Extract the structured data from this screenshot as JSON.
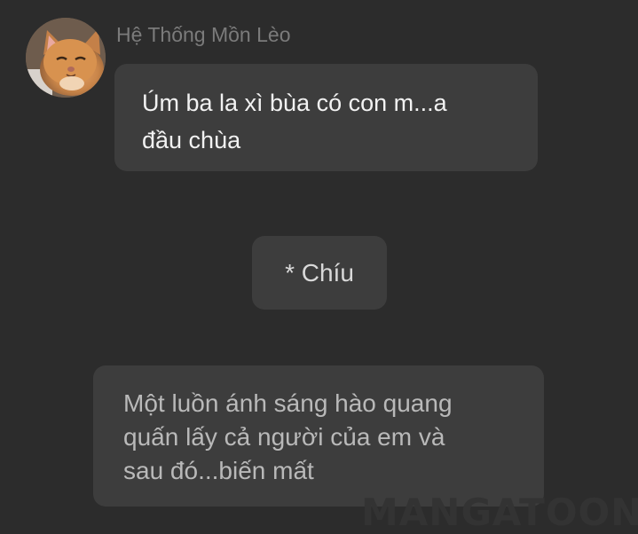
{
  "chat": {
    "sender_name": "Hệ Thống Mồn Lèo",
    "avatar_icon": "cat-avatar-icon",
    "messages": [
      {
        "text": "Úm ba la xì bùa có con m...a\nđầu chùa"
      },
      {
        "text": "* Chíu"
      },
      {
        "text": "Một luồn ánh sáng hào quang\nquấn lấy cả người của em và\nsau đó...biến mất"
      }
    ]
  },
  "watermark": {
    "text": "MANGATOON"
  },
  "colors": {
    "background": "#2c2c2c",
    "bubble": "#3d3d3d",
    "sender_name": "#7b7b7b",
    "message_text": "#f2f2f2",
    "narration_text": "#b9b9b9"
  }
}
